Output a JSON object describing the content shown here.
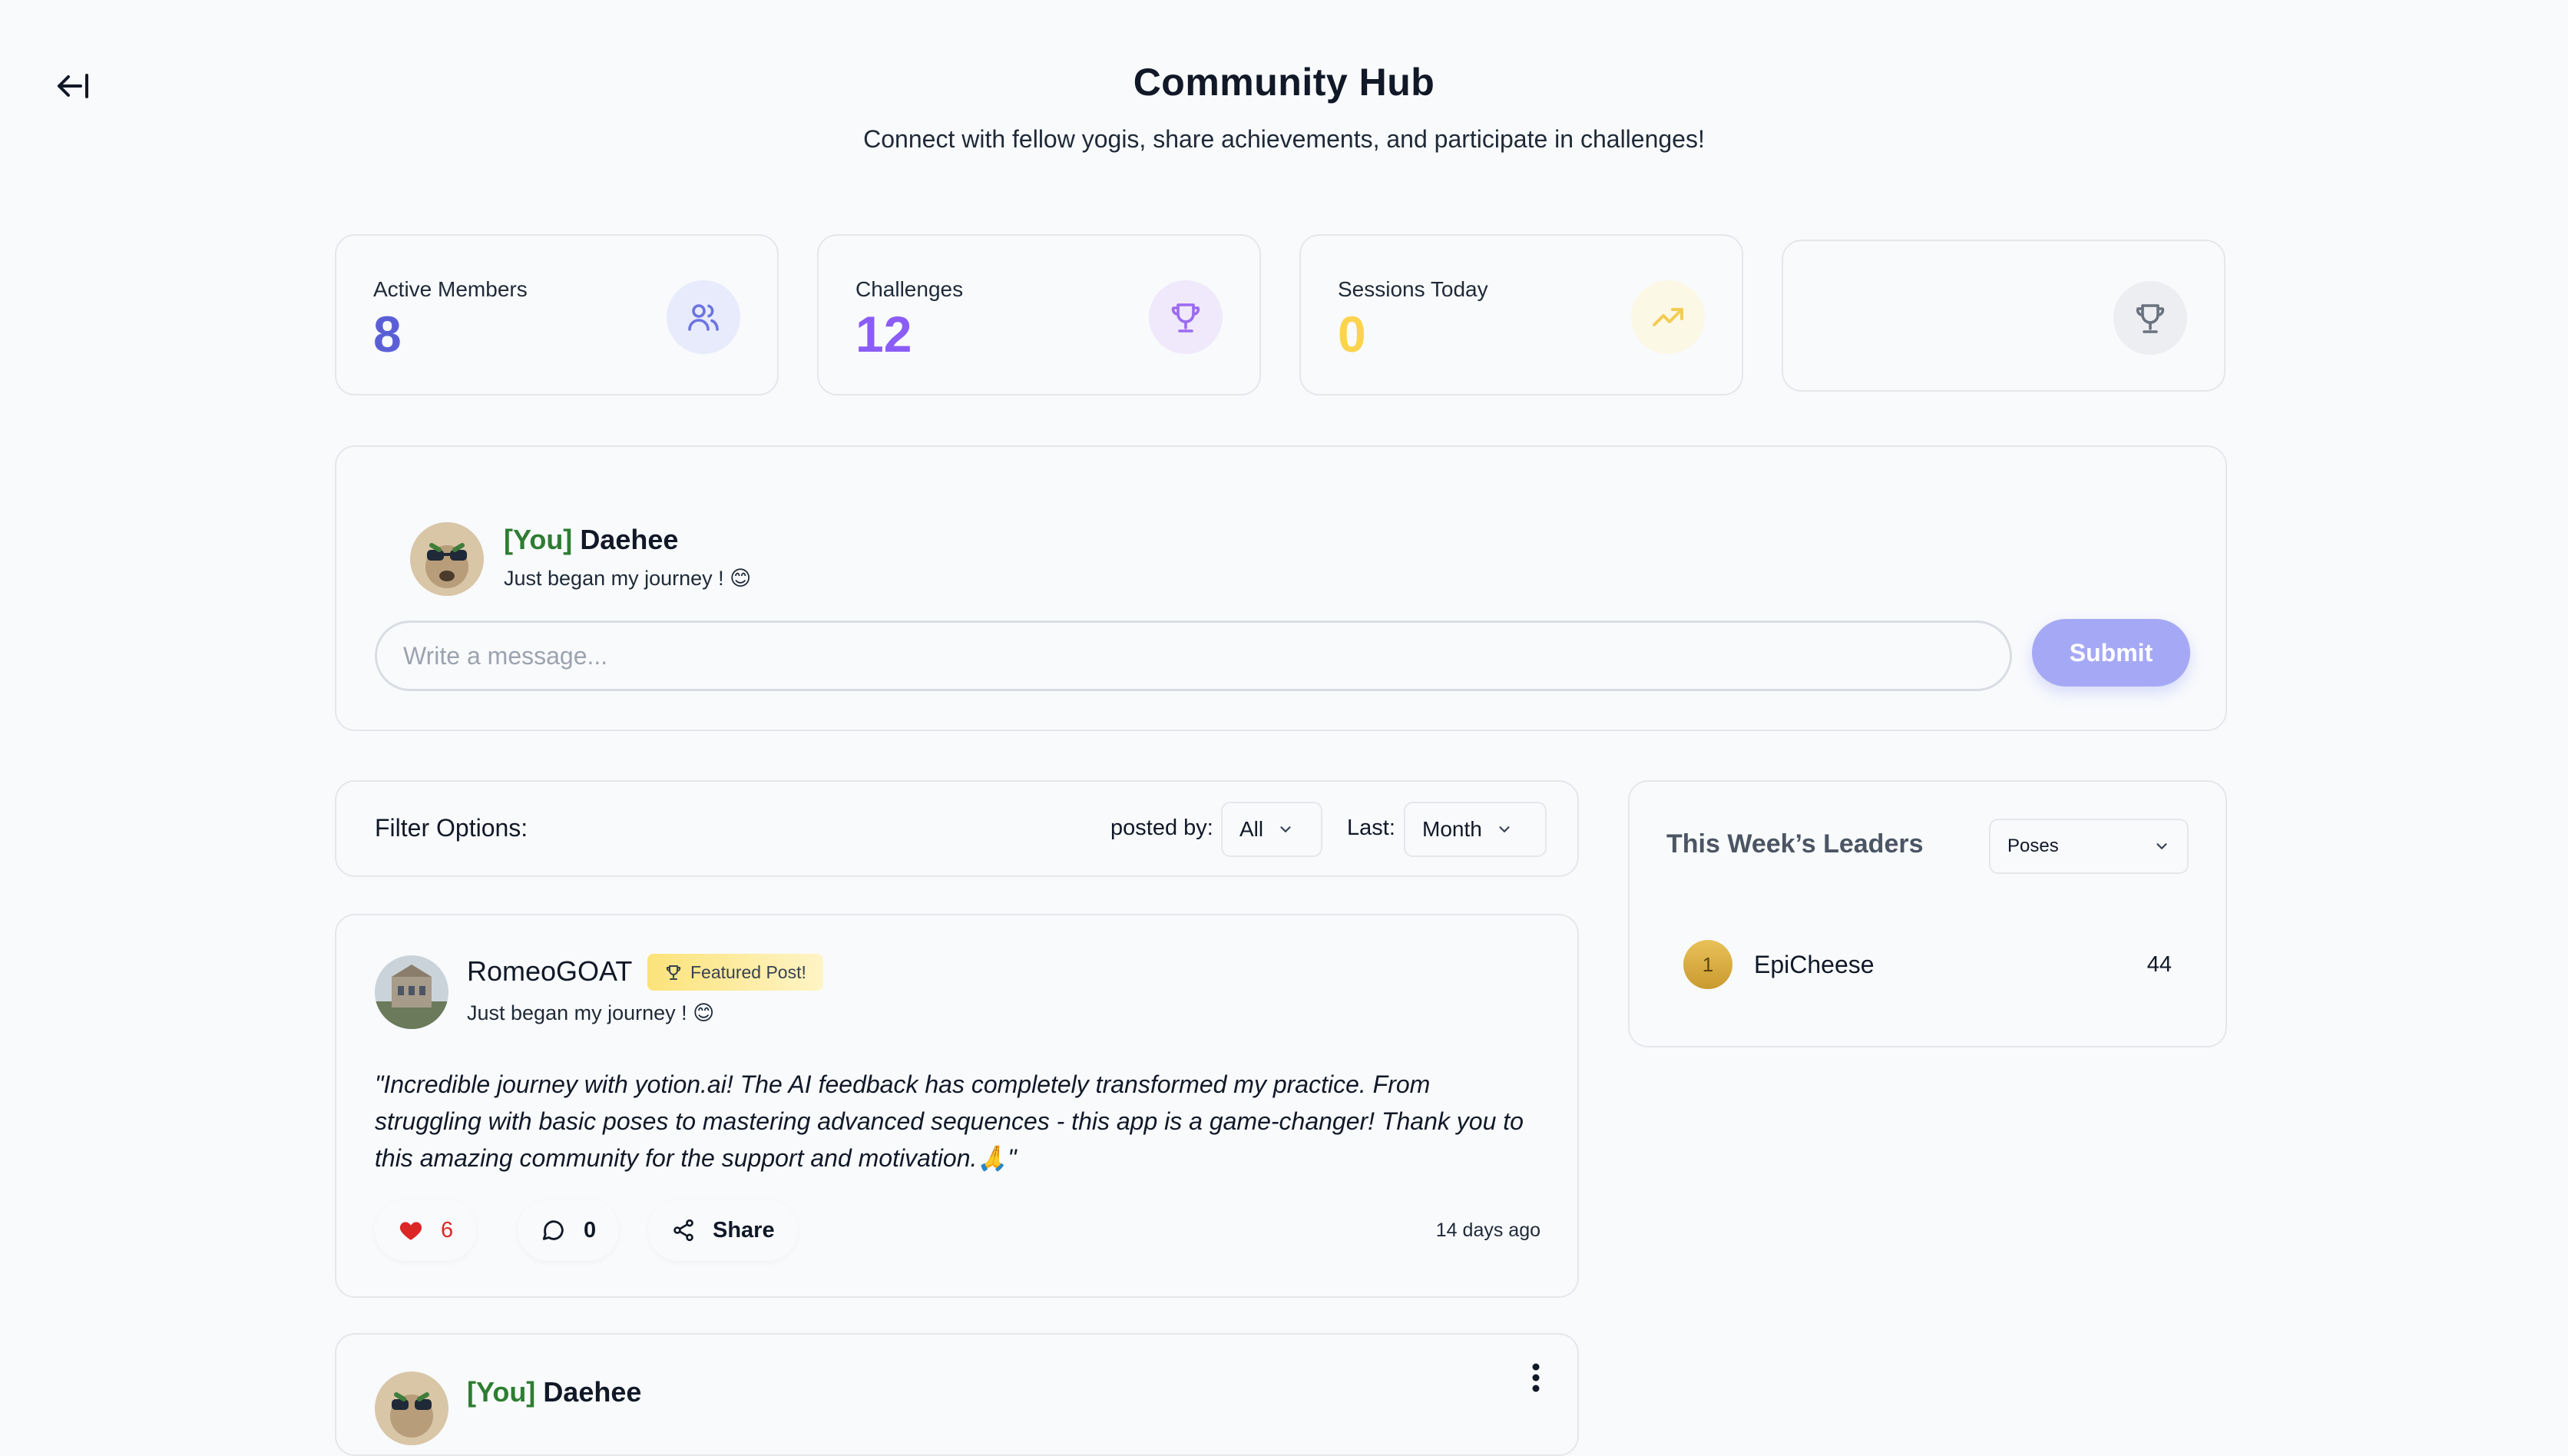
{
  "header": {
    "back_icon": "back-arrow-icon",
    "title": "Community Hub",
    "subtitle": "Connect with fellow yogis, share achievements, and participate in challenges!"
  },
  "stats": [
    {
      "label": "Active Members",
      "value": "8",
      "icon": "users-icon",
      "color": "#5b5fd6",
      "icon_bg": "#e8ebfb",
      "icon_color": "#6b74e0"
    },
    {
      "label": "Challenges",
      "value": "12",
      "icon": "trophy-icon",
      "color": "#8b5cf6",
      "icon_bg": "#efe9fb",
      "icon_color": "#9b6bf0"
    },
    {
      "label": "Sessions Today",
      "value": "0",
      "icon": "trending-up-icon",
      "color": "#fcd34d",
      "icon_bg": "#fcf8e6",
      "icon_color": "#f3cc52"
    },
    {
      "label": "",
      "value": "",
      "icon": "trophy-icon",
      "color": "#6b7280",
      "icon_bg": "#eceef1",
      "icon_color": "#6b7280"
    }
  ],
  "composer": {
    "you_tag": "[You]",
    "username": "Daehee",
    "status": "Just began my journey ! 😊",
    "placeholder": "Write a message...",
    "submit_label": "Submit"
  },
  "filter": {
    "label": "Filter Options:",
    "posted_by_label": "posted by:",
    "posted_by_value": "All",
    "last_label": "Last:",
    "last_value": "Month"
  },
  "post": {
    "username": "RomeoGOAT",
    "badge": "Featured Post!",
    "status": "Just began my journey ! 😊",
    "text": "\"Incredible journey with yotion.ai! The AI feedback has completely transformed my practice. From struggling with basic poses to mastering advanced sequences - this app is a game-changer! Thank you to this amazing community for the support and motivation.🙏\"",
    "likes": "6",
    "comments": "0",
    "share_label": "Share",
    "time": "14 days ago"
  },
  "leaders": {
    "title": "This Week’s Leaders",
    "select_value": "Poses",
    "entries": [
      {
        "rank": "1",
        "name": "EpiCheese",
        "score": "44"
      }
    ]
  },
  "post2": {
    "you_tag": "[You]",
    "username": "Daehee"
  }
}
